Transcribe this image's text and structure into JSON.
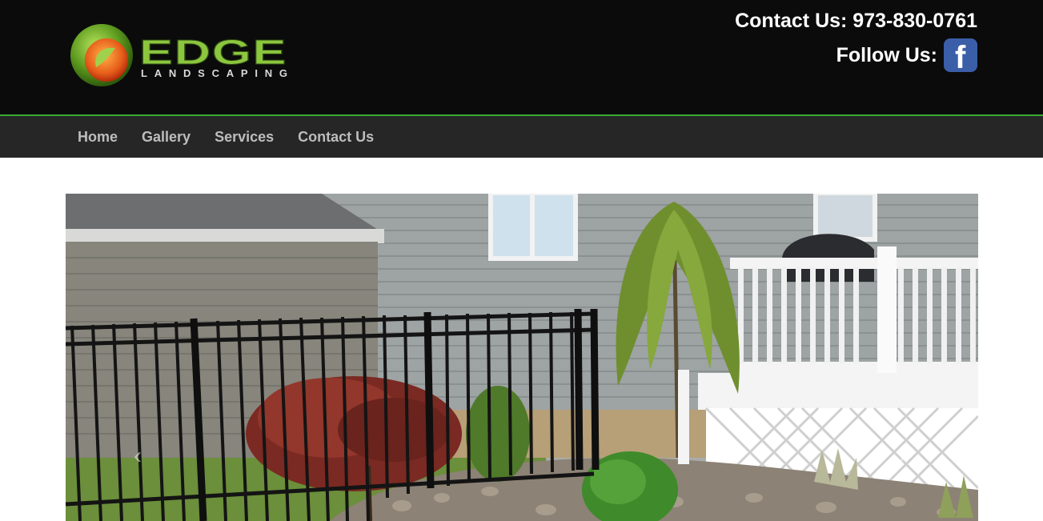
{
  "header": {
    "logo": {
      "word": "EDGE",
      "sub": "LANDSCAPING"
    },
    "contact_text": "Contact Us: 973-830-0761",
    "follow_text": "Follow Us:",
    "facebook_glyph": "f"
  },
  "nav": {
    "items": [
      {
        "label": "Home"
      },
      {
        "label": "Gallery"
      },
      {
        "label": "Services"
      },
      {
        "label": "Contact Us"
      }
    ]
  },
  "slider": {
    "prev_glyph": "‹",
    "next_glyph": "›"
  },
  "colors": {
    "header_bg": "#0b0b0b",
    "nav_bg": "#262626",
    "accent_green": "#39a935",
    "logo_green": "#8cc63f",
    "logo_orange": "#e65c1a",
    "facebook_blue": "#3b5ea8",
    "nav_text": "#bdbdbd"
  }
}
